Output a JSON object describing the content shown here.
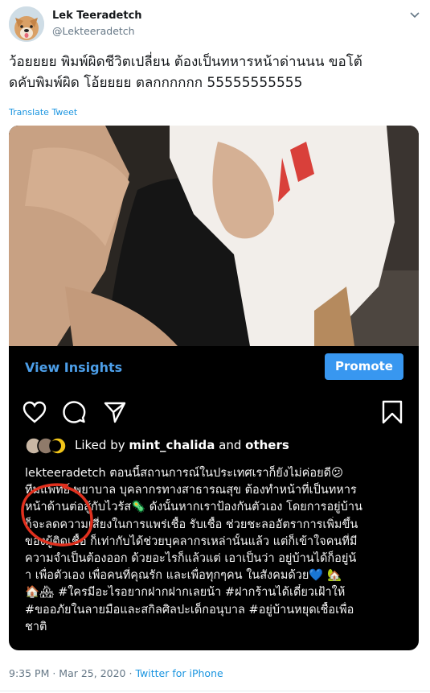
{
  "user": {
    "name": "Lek Teeradetch",
    "handle": "@Lekteeradetch"
  },
  "tweet": {
    "line1": "ว้อยยยย พิมพ์ผิดชีวิตเปลี่ยน ต้องเป็นทหารหน้าด่านนน ขอโต้",
    "line2": "ดคับพิมพ์ผิด โอ้ยยยย ตลกกกกกก 55555555555",
    "translate": "Translate Tweet"
  },
  "instagram": {
    "insights": "View Insights",
    "promote": "Promote",
    "liked_by_prefix": "Liked by",
    "liked_by_user": "mint_chalida",
    "liked_by_and": "and",
    "liked_by_others": "others",
    "caption_lines": [
      "lekteeradetch ตอนนี้สถานการณ์ในประเทศเราก็ยังไม่ค่อยดี😕",
      "ทีมแพทย์ พยาบาล บุคลากรทางสาธารณสุข ต้องทำหน้าที่เป็นทหาร",
      "หน้าด้านต่อสู้กับไวรัส🦠 ดังนั้นหากเราป้องกันตัวเอง โดยการอยู่บ้าน",
      "ก็จะลดความเสี่ยงในการแพร่เชื้อ รับเชื้อ ช่วยชะลออัตราการเพิ่มขึ้น",
      "ของผู้ติดเชื้อ ก็เท่ากับได้ช่วยบุคลากรเหล่านั้นแล้ว แต่ก็เข้าใจคนที่มี",
      "ความจำเป็นต้องออก ด้วยอะไรก็แล้วแต่ เอาเป็นว่า อยู่บ้านได้ก็อยู่น้",
      "า เพื่อตัวเอง เพื่อคนที่คุณรัก และเพื่อทุกๆคน ในสังคมด้วย💙 🏡",
      "🏠🏘 #ใครมีอะไรอยากฝากฝากเลยน้า #ฝากร้านได้เดี๋ยวเฝ้าให้",
      "#ขออภัยในลายมือและสกิลศิลปะเด็กอนุบาล #อยู่บ้านหยุดเชื้อเพื่อ",
      "ชาติ"
    ]
  },
  "footer": {
    "time": "9:35 PM · Mar 25, 2020 ·",
    "source": "Twitter for iPhone"
  },
  "icons": {
    "chevron": "chevron-down-icon",
    "like": "heart-icon",
    "comment": "comment-icon",
    "share": "send-icon",
    "save": "bookmark-icon"
  },
  "colors": {
    "link": "#1b95e0",
    "insights": "#4c9ee8",
    "promote": "#3897f0",
    "annotation": "#e0301e"
  }
}
